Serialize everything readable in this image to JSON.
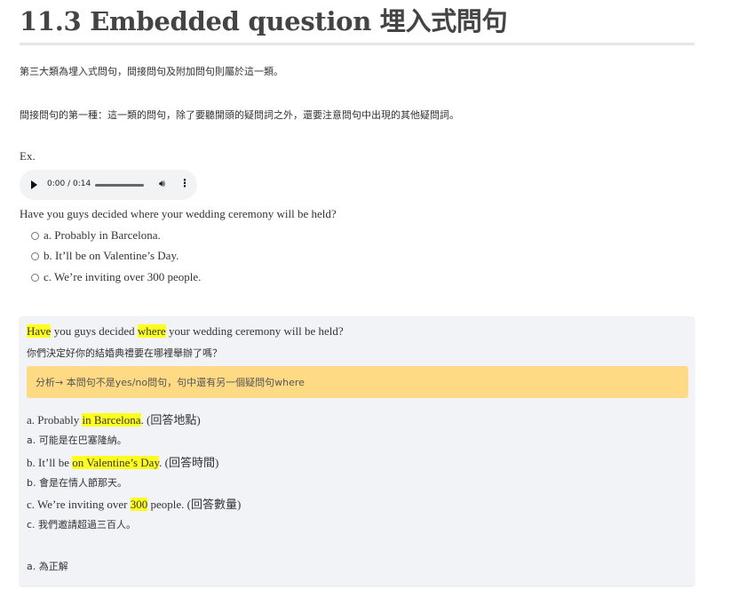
{
  "heading": "11.3 Embedded question 埋入式問句",
  "intro1": "第三大類為埋入式問句，間接問句及附加問句則屬於這一類。",
  "intro2": "間接問句的第一種：這一類的問句，除了要聽開頭的疑問詞之外，還要注意問句中出現的其他疑問詞。",
  "ex_label": "Ex.",
  "audio": {
    "time": "0:00 / 0:14"
  },
  "question": "Have you guys decided where your wedding ceremony will be held?",
  "options": [
    "a. Probably in Barcelona.",
    "b. It’ll be on Valentine’s Day.",
    "c. We’re inviting over 300 people."
  ],
  "explanation": {
    "q_hl1": "Have",
    "q_mid1": " you guys decided ",
    "q_hl2": "where",
    "q_end": " your wedding ceremony will be held?",
    "q_translation": "你們決定好你的結婚典禮要在哪裡舉辦了嗎？",
    "analysis": "分析→ 本問句不是yes/no問句，句中還有另一個疑問句where",
    "a_pre": "a. Probably ",
    "a_hl": "in Barcelona",
    "a_post": ". (回答地點)",
    "a_trans": "a. 可能是在巴塞隆納。",
    "b_pre": "b. It’ll be ",
    "b_hl": "on Valentine’s Day",
    "b_post": ". (回答時間)",
    "b_trans": "b. 會是在情人節那天。",
    "c_pre": "c. We’re inviting over ",
    "c_hl": "300",
    "c_post": " people. (回答數量)",
    "c_trans": "c. 我們邀請超過三百人。",
    "answer": "a. 為正解"
  }
}
